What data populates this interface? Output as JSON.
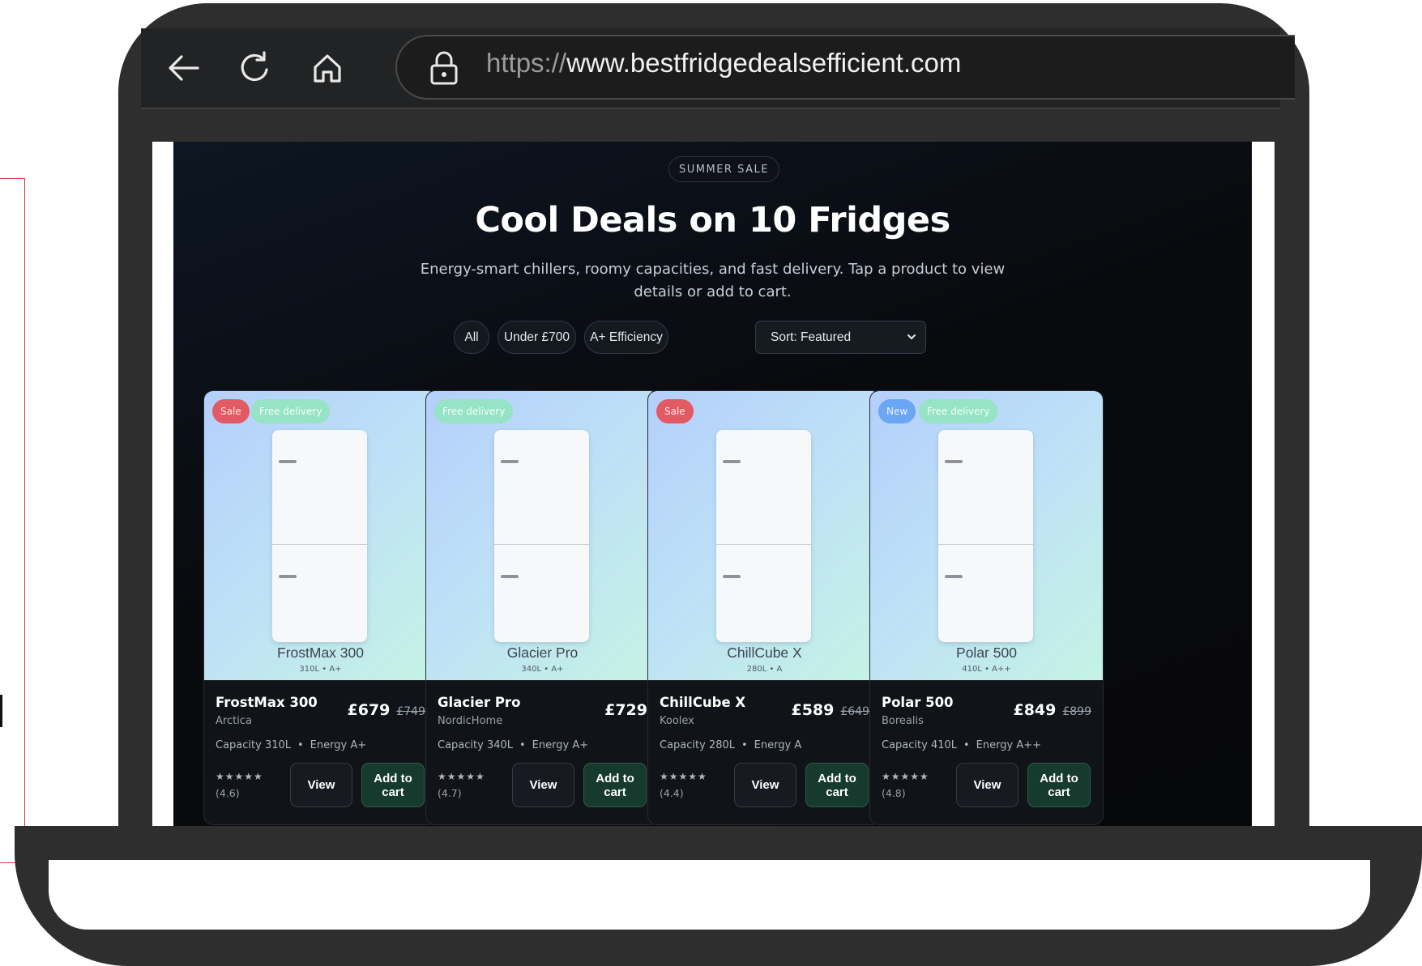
{
  "browser": {
    "url_scheme": "https://",
    "url_host": "www.bestfridgedealsefficient.com"
  },
  "hero": {
    "pill": "SUMMER SALE",
    "title": "Cool Deals on 10 Fridges",
    "subtitle": "Energy-smart chillers, roomy capacities, and fast delivery. Tap a product to view details or add to cart."
  },
  "filters": {
    "chips": [
      "All",
      "Under £700",
      "A+ Efficiency"
    ],
    "sort_selected": "Sort: Featured"
  },
  "products": [
    {
      "name": "FrostMax 300",
      "brand": "Arctica",
      "img_spec": "310L • A+",
      "price": "£679",
      "was_price": "£749",
      "capacity": "Capacity 310L",
      "energy": "Energy A+",
      "stars": "★★★★★",
      "rating": "(4.6)",
      "badges": [
        {
          "type": "sale",
          "label": "Sale"
        },
        {
          "type": "free",
          "label": "Free delivery"
        }
      ],
      "view_label": "View",
      "cart_label": "Add to cart"
    },
    {
      "name": "Glacier Pro",
      "brand": "NordicHome",
      "img_spec": "340L • A+",
      "price": "£729",
      "was_price": "",
      "capacity": "Capacity 340L",
      "energy": "Energy A+",
      "stars": "★★★★★",
      "rating": "(4.7)",
      "badges": [
        {
          "type": "free",
          "label": "Free delivery"
        }
      ],
      "view_label": "View",
      "cart_label": "Add to cart"
    },
    {
      "name": "ChillCube X",
      "brand": "Koolex",
      "img_spec": "280L • A",
      "price": "£589",
      "was_price": "£649",
      "capacity": "Capacity 280L",
      "energy": "Energy A",
      "stars": "★★★★★",
      "rating": "(4.4)",
      "badges": [
        {
          "type": "sale",
          "label": "Sale"
        }
      ],
      "view_label": "View",
      "cart_label": "Add to cart"
    },
    {
      "name": "Polar 500",
      "brand": "Borealis",
      "img_spec": "410L • A++",
      "price": "£849",
      "was_price": "£899",
      "capacity": "Capacity 410L",
      "energy": "Energy A++",
      "stars": "★★★★★",
      "rating": "(4.8)",
      "badges": [
        {
          "type": "new",
          "label": "New"
        },
        {
          "type": "free",
          "label": "Free delivery"
        }
      ],
      "view_label": "View",
      "cart_label": "Add to cart"
    }
  ],
  "icons": {
    "back": "arrow-left-icon",
    "reload": "refresh-icon",
    "home": "home-icon",
    "lock": "lock-icon",
    "sort": "chevron-down-icon"
  },
  "colors": {
    "sale_badge": "#e25a63",
    "new_badge": "#6aa6f4",
    "free_badge": "#96e3c5",
    "cart_button": "#163a2d",
    "page_bg": "#07080a"
  }
}
